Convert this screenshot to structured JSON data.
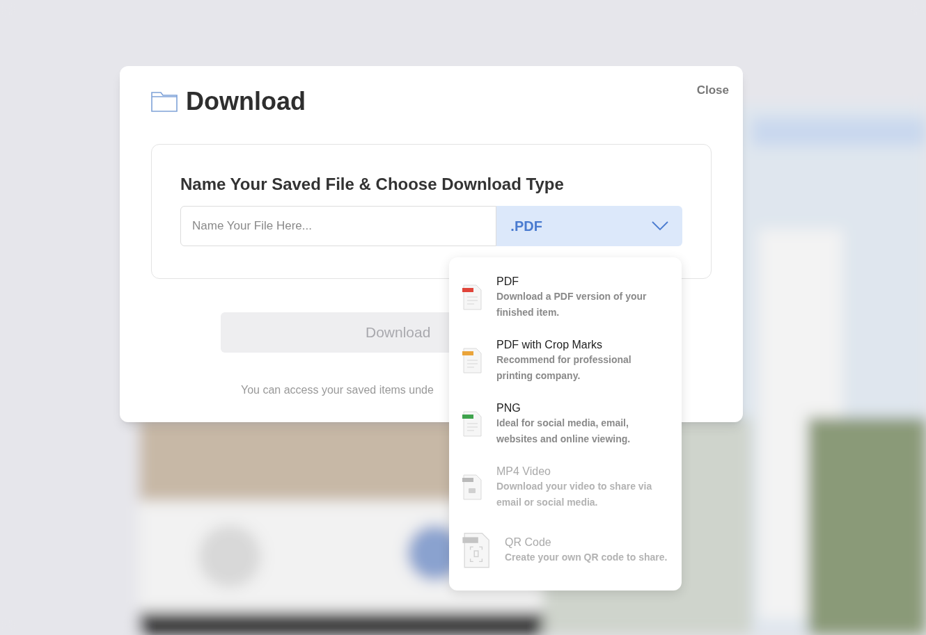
{
  "dialog": {
    "title": "Download",
    "close": "Close"
  },
  "form": {
    "heading": "Name Your Saved File & Choose Download Type",
    "placeholder": "Name Your File Here...",
    "type_value": ".PDF",
    "expanded": true
  },
  "options": [
    {
      "kind": "document",
      "color": "#e0443a",
      "title": "PDF",
      "description": "Download a PDF version of your finished item.",
      "disabled": false
    },
    {
      "kind": "document",
      "color": "#eaa43a",
      "title": "PDF with Crop Marks",
      "description": "Recommend for professional printing company.",
      "disabled": false
    },
    {
      "kind": "document",
      "color": "#3fa34d",
      "title": "PNG",
      "description": "Ideal for social media, email, websites and online viewing.",
      "disabled": false
    },
    {
      "kind": "video",
      "color": "#b9b9b9",
      "title": "MP4 Video",
      "description": "Download your video to share via email or social media.",
      "disabled": true
    },
    {
      "kind": "qr",
      "color": "#c4c4c4",
      "title": "QR Code",
      "description": "Create your own QR code to share.",
      "disabled": true
    }
  ],
  "download_button": {
    "label": "Download",
    "disabled": true
  },
  "note": "You can access your saved items unde"
}
